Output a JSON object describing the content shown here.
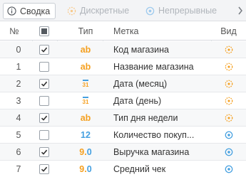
{
  "tabs": [
    {
      "label": "Сводка",
      "active": true,
      "icon": "info-icon"
    },
    {
      "label": "Дискретные",
      "active": false,
      "icon": "discrete-icon"
    },
    {
      "label": "Непрерывные",
      "active": false,
      "icon": "continuous-icon"
    }
  ],
  "columns": {
    "num": "№",
    "type": "Тип",
    "label": "Метка",
    "kind": "Вид"
  },
  "colors": {
    "discrete": "#f5a020",
    "continuous": "#46a0e0"
  },
  "rows": [
    {
      "num": "0",
      "checked": true,
      "type_icon": "ab",
      "type_kind": "text",
      "label": "Код магазина",
      "kind": "discrete"
    },
    {
      "num": "1",
      "checked": false,
      "type_icon": "ab",
      "type_kind": "text",
      "label": "Название магазина",
      "kind": "discrete"
    },
    {
      "num": "2",
      "checked": true,
      "type_icon": "31",
      "type_kind": "date",
      "label": "Дата (месяц)",
      "kind": "discrete"
    },
    {
      "num": "3",
      "checked": false,
      "type_icon": "31",
      "type_kind": "date",
      "label": "Дата (день)",
      "kind": "discrete"
    },
    {
      "num": "4",
      "checked": true,
      "type_icon": "ab",
      "type_kind": "text",
      "label": "Тип дня недели",
      "kind": "discrete"
    },
    {
      "num": "5",
      "checked": false,
      "type_icon": "12",
      "type_kind": "number",
      "label": "Количество покуп...",
      "kind": "continuous"
    },
    {
      "num": "6",
      "checked": true,
      "type_icon": "9.0",
      "type_kind": "float",
      "label": "Выручка магазина",
      "kind": "continuous"
    },
    {
      "num": "7",
      "checked": true,
      "type_icon": "9.0",
      "type_kind": "float",
      "label": "Средний чек",
      "kind": "continuous"
    }
  ]
}
